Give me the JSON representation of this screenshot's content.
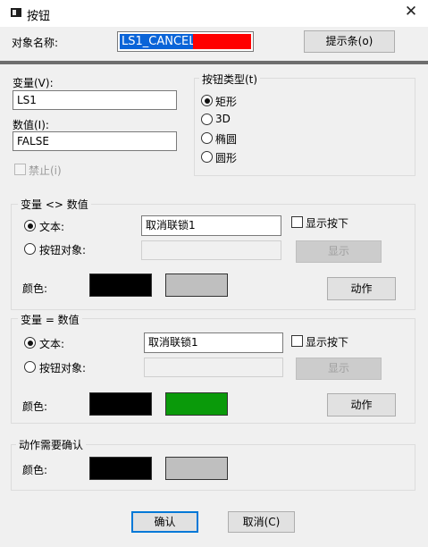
{
  "window": {
    "title": "按钮",
    "close_glyph": "✕"
  },
  "object_name": {
    "label": "对象名称:",
    "value": "LS1_CANCEL",
    "tooltip_button": "提示条(o)"
  },
  "variable": {
    "label": "变量(V):",
    "value": "LS1"
  },
  "value": {
    "label": "数值(I):",
    "value": "FALSE"
  },
  "disable": {
    "label": "禁止(i)",
    "checked": false
  },
  "button_type": {
    "legend": "按钮类型(t)",
    "options": [
      {
        "label": "矩形",
        "checked": true
      },
      {
        "label": "3D",
        "checked": false
      },
      {
        "label": "椭圆",
        "checked": false
      },
      {
        "label": "圆形",
        "checked": false
      }
    ]
  },
  "section_neq": {
    "legend": "变量 <> 数值",
    "text_option": "文本:",
    "button_object_option": "按钮对象:",
    "text_value": "取消联锁1",
    "show_pressed_label": "显示按下",
    "display_button": "显示",
    "color_label": "颜色:",
    "action_button": "动作",
    "colors": {
      "foreground": "#000000",
      "background": "#bfbfbf"
    }
  },
  "section_eq": {
    "legend": "变量 = 数值",
    "text_option": "文本:",
    "button_object_option": "按钮对象:",
    "text_value": "取消联锁1",
    "show_pressed_label": "显示按下",
    "display_button": "显示",
    "color_label": "颜色:",
    "action_button": "动作",
    "colors": {
      "foreground": "#000000",
      "background": "#0a9a0a"
    }
  },
  "confirm_section": {
    "legend": "动作需要确认",
    "color_label": "颜色:",
    "colors": {
      "foreground": "#000000",
      "background": "#bfbfbf"
    }
  },
  "footer": {
    "ok_button": "确认",
    "cancel_button": "取消(C)"
  }
}
